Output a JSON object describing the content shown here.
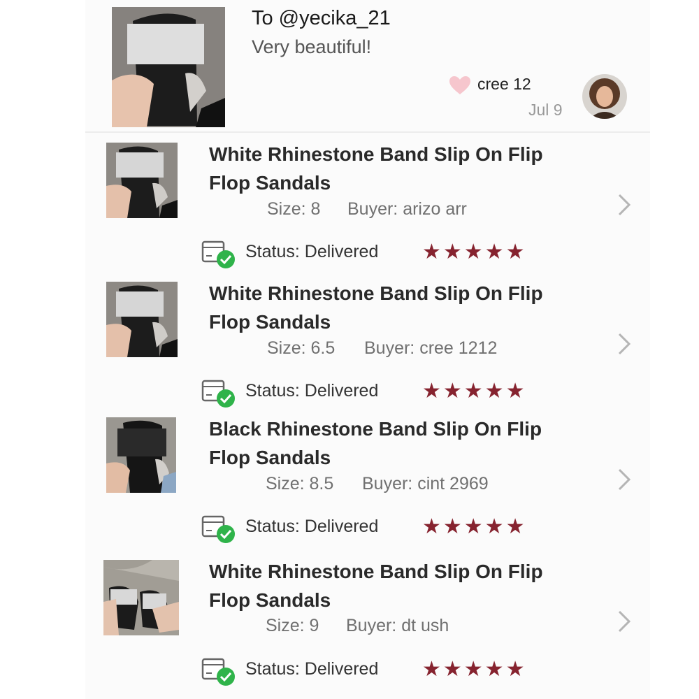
{
  "comment": {
    "to_text": "To @yecika_21",
    "message": "Very beautiful!",
    "username": "cree      12",
    "date": "Jul 9",
    "heart_color": "#f6c6cd"
  },
  "orders": [
    {
      "title": "White Rhinestone Band Slip On Flip Flop Sandals",
      "size": "Size: 8",
      "buyer": "Buyer: arizo        arr",
      "status": "Status: Delivered",
      "stars": "★★★★★",
      "rating": 5
    },
    {
      "title": "White Rhinestone Band Slip On Flip Flop Sandals",
      "size": "Size: 6.5",
      "buyer": "Buyer: cree     1212",
      "status": "Status: Delivered",
      "stars": "★★★★★",
      "rating": 5
    },
    {
      "title": "Black Rhinestone Band Slip On Flip Flop Sandals",
      "size": "Size: 8.5",
      "buyer": "Buyer: cint      2969",
      "status": "Status: Delivered",
      "stars": "★★★★★",
      "rating": 5
    },
    {
      "title": "White Rhinestone Band Slip On Flip Flop Sandals",
      "size": "Size: 9",
      "buyer": "Buyer: dt     ush",
      "status": "Status: Delivered",
      "stars": "★★★★★",
      "rating": 5
    }
  ],
  "colors": {
    "star": "#86232f",
    "check": "#2fb34a"
  },
  "icons": {
    "row_chevron": "chevron-right-icon",
    "status": "delivered-box-icon"
  }
}
